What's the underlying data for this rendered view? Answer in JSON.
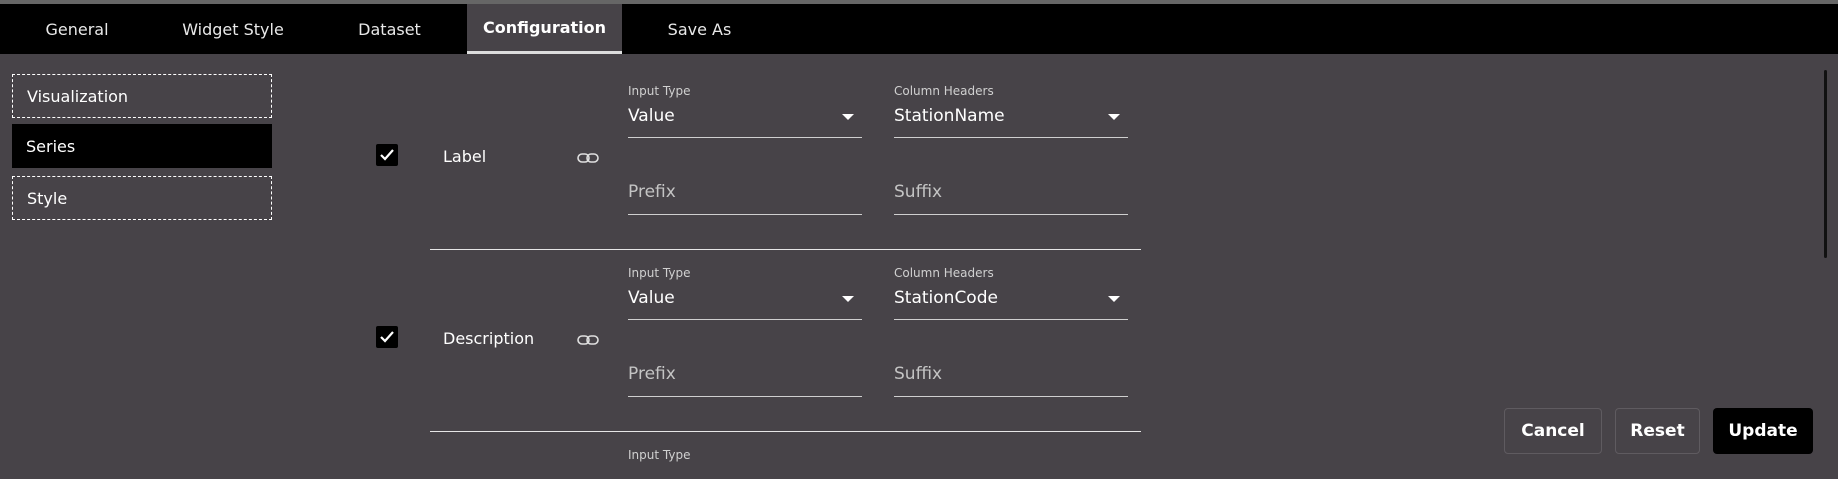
{
  "tabs": [
    {
      "label": "General"
    },
    {
      "label": "Widget Style"
    },
    {
      "label": "Dataset"
    },
    {
      "label": "Configuration"
    },
    {
      "label": "Save As"
    }
  ],
  "sidebar": {
    "items": [
      {
        "label": "Visualization"
      },
      {
        "label": "Series"
      },
      {
        "label": "Style"
      }
    ]
  },
  "rows": [
    {
      "checked": true,
      "label": "Label",
      "input_type_caption": "Input Type",
      "input_type_value": "Value",
      "column_headers_caption": "Column Headers",
      "column_headers_value": "StationName",
      "prefix_placeholder": "Prefix",
      "suffix_placeholder": "Suffix"
    },
    {
      "checked": true,
      "label": "Description",
      "input_type_caption": "Input Type",
      "input_type_value": "Value",
      "column_headers_caption": "Column Headers",
      "column_headers_value": "StationCode",
      "prefix_placeholder": "Prefix",
      "suffix_placeholder": "Suffix"
    },
    {
      "input_type_caption": "Input Type"
    }
  ],
  "actions": {
    "cancel_label": "Cancel",
    "reset_label": "Reset",
    "update_label": "Update"
  },
  "icons": {
    "checkbox": "check-icon",
    "link": "link-icon",
    "dropdown": "caret-down-icon"
  },
  "colors": {
    "background": "#474348",
    "tabbar": "#000000",
    "primary_button": "#000000"
  }
}
